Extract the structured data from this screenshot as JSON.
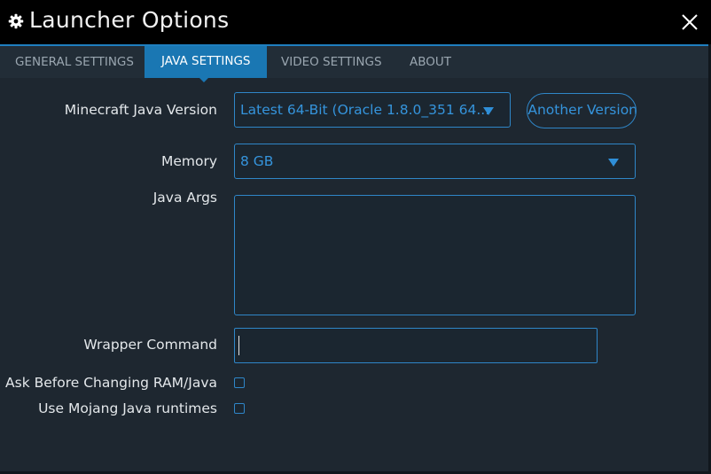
{
  "window": {
    "title": "Launcher Options",
    "icons": {
      "settings": "gear-icon",
      "close": "close-icon"
    }
  },
  "tabs": [
    {
      "label": "GENERAL SETTINGS",
      "active": false
    },
    {
      "label": "JAVA SETTINGS",
      "active": true
    },
    {
      "label": "VIDEO SETTINGS",
      "active": false
    },
    {
      "label": "ABOUT",
      "active": false
    }
  ],
  "java": {
    "version_label": "Minecraft Java Version",
    "version_value": "Latest 64-Bit (Oracle 1.8.0_351 64...",
    "add_button_label": "Find Another Version",
    "memory_label": "Memory",
    "memory_value": "8 GB",
    "args_label": "Java Args",
    "args_value": "",
    "wrapper_label": "Wrapper Command",
    "wrapper_value": "",
    "ask_ram_label": "Ask Before Changing RAM/Java",
    "ask_ram_checked": false,
    "mojang_runtime_label": "Use Mojang Java runtimes",
    "mojang_runtime_checked": false
  },
  "colors": {
    "accent": "#1a77b3",
    "accent_text": "#3594dc",
    "background": "#1e2730",
    "titlebar": "#000000"
  }
}
